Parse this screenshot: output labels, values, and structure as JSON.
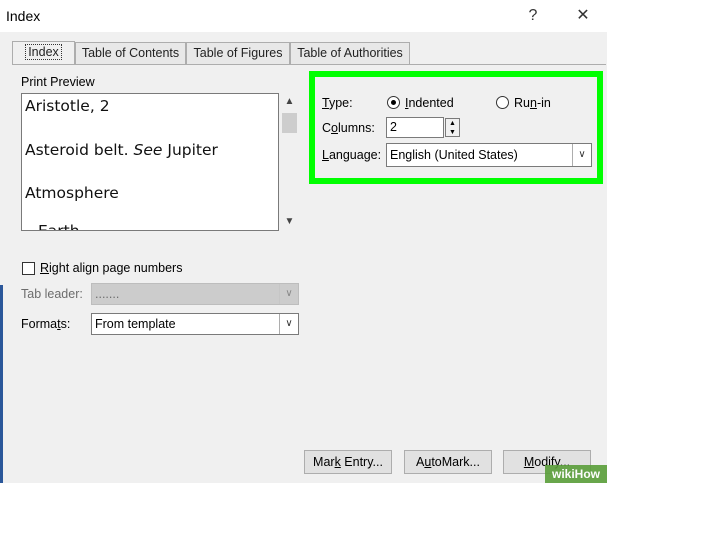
{
  "window": {
    "title": "Index",
    "help_label": "?",
    "close_label": "✕"
  },
  "tabs": [
    "Index",
    "Table of Contents",
    "Table of Figures",
    "Table of Authorities"
  ],
  "print_preview": {
    "label": "Print Preview",
    "lines": [
      "Aristotle, 2",
      "Asteroid belt.",
      "See",
      "Jupiter",
      "Atmosphere",
      "Earth"
    ]
  },
  "right_align": {
    "label_mnemonic": "R",
    "label_rest": "ight align page numbers",
    "checked": false
  },
  "tab_leader": {
    "label": "Tab leader:",
    "value": "......."
  },
  "formats": {
    "label_prefix": "Forma",
    "label_mnemonic": "t",
    "label_suffix": "s:",
    "value": "From template"
  },
  "type": {
    "label_mnemonic": "T",
    "label_rest": "ype:",
    "options": [
      {
        "mnemonic": "I",
        "rest": "ndented",
        "selected": true
      },
      {
        "prefix": "Ru",
        "mnemonic": "n",
        "rest": "-in",
        "selected": false
      }
    ]
  },
  "columns": {
    "label_prefix": "C",
    "label_mnemonic": "o",
    "label_rest": "lumns:",
    "value": "2"
  },
  "language": {
    "label_mnemonic": "L",
    "label_rest": "anguage:",
    "value": "English (United States)"
  },
  "buttons": {
    "mark_entry": {
      "prefix": "Mar",
      "mnemonic": "k",
      "rest": " Entry..."
    },
    "automark": {
      "prefix": "A",
      "mnemonic": "u",
      "rest": "toMark..."
    },
    "modify": {
      "prefix": "",
      "mnemonic": "M",
      "rest": "odify..."
    }
  },
  "watermark": "wikiHow",
  "colors": {
    "highlight": "#00ff00",
    "dialog_bg": "#f0f0f0"
  }
}
